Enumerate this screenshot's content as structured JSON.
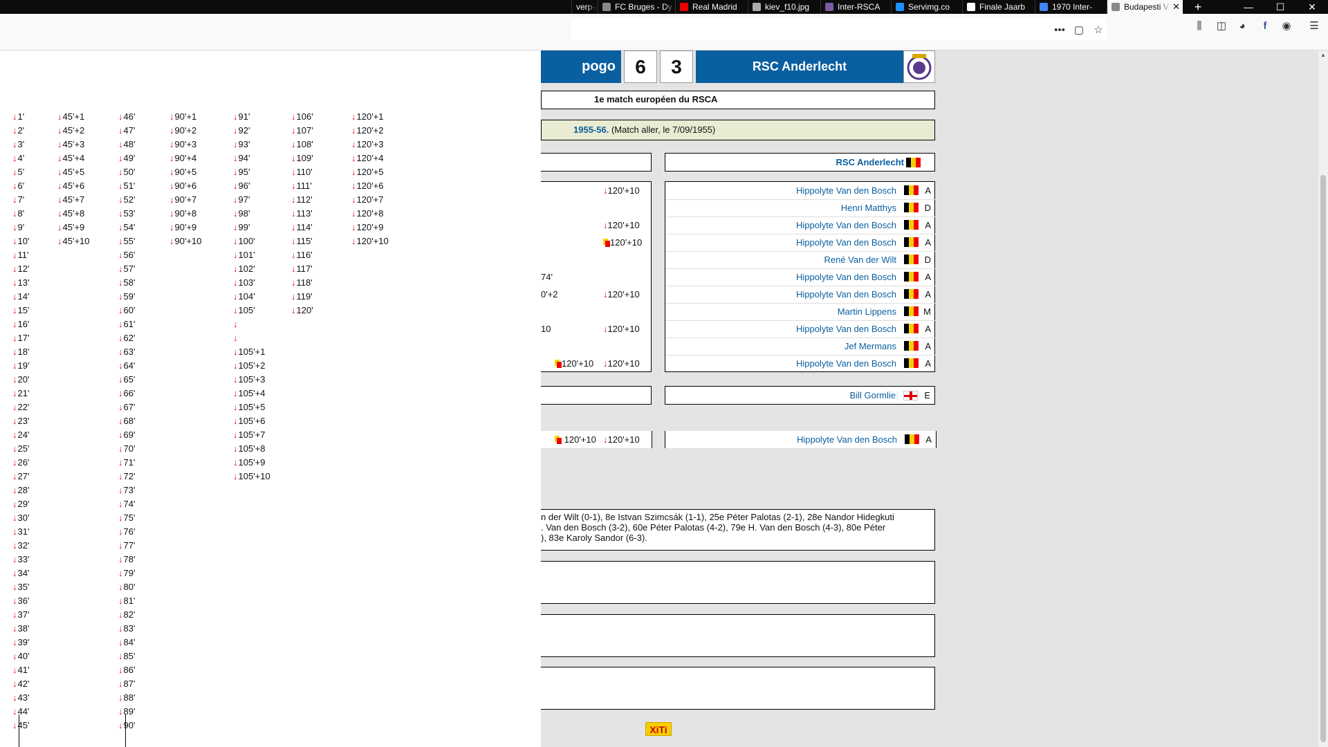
{
  "browser": {
    "tabs": [
      {
        "label": "verp-A",
        "color": "#888"
      },
      {
        "label": "FC Bruges - Dy",
        "color": "#888"
      },
      {
        "label": "Real Madrid",
        "color": "#e00"
      },
      {
        "label": "kiev_f10.jpg",
        "color": "#aaa"
      },
      {
        "label": "Inter-RSCA",
        "color": "#7a5aa0"
      },
      {
        "label": "Servimg.co",
        "color": "#1e90ff"
      },
      {
        "label": "Finale Jaarb",
        "color": "#fff"
      },
      {
        "label": "1970 Inter-",
        "color": "#4285f4"
      },
      {
        "label": "Budapesti V",
        "color": "#888",
        "active": true
      }
    ],
    "new_tab": "+",
    "win_min": "—",
    "win_max": "☐",
    "win_close": "✕"
  },
  "match": {
    "home_partial": "pogo",
    "home_score": "6",
    "away_score": "3",
    "away_team": "RSC Anderlecht",
    "subtitle": "1e match européen du RSCA",
    "season_link": "1955-56.",
    "season_note": " (Match aller, le 7/09/1955)",
    "team_header": "RSC Anderlecht",
    "left_events": [
      "120'+10",
      "120'+10",
      "120'+10",
      "",
      "74'",
      "120'+10",
      "",
      "120'+10",
      "",
      "120'+10"
    ],
    "left_events_extra": [
      "",
      "",
      "",
      "",
      "",
      "0'+2",
      "",
      "10",
      "",
      "120'+10"
    ],
    "players": [
      {
        "name": "Hippolyte Van den Bosch",
        "pos": "A"
      },
      {
        "name": "Henri Matthys",
        "pos": "D"
      },
      {
        "name": "Hippolyte Van den Bosch",
        "pos": "A"
      },
      {
        "name": "Hippolyte Van den Bosch",
        "pos": "A"
      },
      {
        "name": "René Van der Wilt",
        "pos": "D"
      },
      {
        "name": "Hippolyte Van den Bosch",
        "pos": "A"
      },
      {
        "name": "Hippolyte Van den Bosch",
        "pos": "A"
      },
      {
        "name": "Martin Lippens",
        "pos": "M"
      },
      {
        "name": "Hippolyte Van den Bosch",
        "pos": "A"
      },
      {
        "name": "Jef Mermans",
        "pos": "A"
      },
      {
        "name": "Hippolyte Van den Bosch",
        "pos": "A"
      }
    ],
    "coach": {
      "name": "Bill Gormlie",
      "pos": "E"
    },
    "sub_row": {
      "left1": "120'+10",
      "left2": "120'+10",
      "name": "Hippolyte Van den Bosch",
      "pos": "A"
    },
    "goals_text_1": "n der Wilt (0-1), 8e Istvan Szimcsák (1-1), 25e Péter Palotas (2-1), 28e Nandor Hidegkuti",
    "goals_text_2": ". Van den Bosch (3-2), 60e Péter Palotas (4-2), 79e H. Van den Bosch (4-3), 80e Péter",
    "goals_text_3": "), 83e Karoly Sandor (6-3).",
    "xiti": "XiTi"
  },
  "minutes": {
    "col1": [
      "1'",
      "2'",
      "3'",
      "4'",
      "5'",
      "6'",
      "7'",
      "8'",
      "9'",
      "10'",
      "11'",
      "12'",
      "13'",
      "14'",
      "15'",
      "16'",
      "17'",
      "18'",
      "19'",
      "20'",
      "21'",
      "22'",
      "23'",
      "24'",
      "25'",
      "26'",
      "27'",
      "28'",
      "29'",
      "30'",
      "31'",
      "32'",
      "33'",
      "34'",
      "35'",
      "36'",
      "37'",
      "38'",
      "39'",
      "40'",
      "41'",
      "42'",
      "43'",
      "44'",
      "45'"
    ],
    "col2": [
      "45'+1",
      "45'+2",
      "45'+3",
      "45'+4",
      "45'+5",
      "45'+6",
      "45'+7",
      "45'+8",
      "45'+9",
      "45'+10"
    ],
    "col3": [
      "46'",
      "47'",
      "48'",
      "49'",
      "50'",
      "51'",
      "52'",
      "53'",
      "54'",
      "55'",
      "56'",
      "57'",
      "58'",
      "59'",
      "60'",
      "61'",
      "62'",
      "63'",
      "64'",
      "65'",
      "66'",
      "67'",
      "68'",
      "69'",
      "70'",
      "71'",
      "72'",
      "73'",
      "74'",
      "75'",
      "76'",
      "77'",
      "78'",
      "79'",
      "80'",
      "81'",
      "82'",
      "83'",
      "84'",
      "85'",
      "86'",
      "87'",
      "88'",
      "89'",
      "90'"
    ],
    "col4": [
      "90'+1",
      "90'+2",
      "90'+3",
      "90'+4",
      "90'+5",
      "90'+6",
      "90'+7",
      "90'+8",
      "90'+9",
      "90'+10"
    ],
    "col5": [
      "91'",
      "92'",
      "93'",
      "94'",
      "95'",
      "96'",
      "97'",
      "98'",
      "99'",
      "100'",
      "101'",
      "102'",
      "103'",
      "104'",
      "105'",
      "",
      "",
      "105'+1",
      "105'+2",
      "105'+3",
      "105'+4",
      "105'+5",
      "105'+6",
      "105'+7",
      "105'+8",
      "105'+9",
      "105'+10"
    ],
    "col6": [
      "106'",
      "107'",
      "108'",
      "109'",
      "110'",
      "111'",
      "112'",
      "113'",
      "114'",
      "115'",
      "116'",
      "117'",
      "118'",
      "119'",
      "120'"
    ],
    "col7": [
      "120'+1",
      "120'+2",
      "120'+3",
      "120'+4",
      "120'+5",
      "120'+6",
      "120'+7",
      "120'+8",
      "120'+9",
      "120'+10"
    ]
  }
}
